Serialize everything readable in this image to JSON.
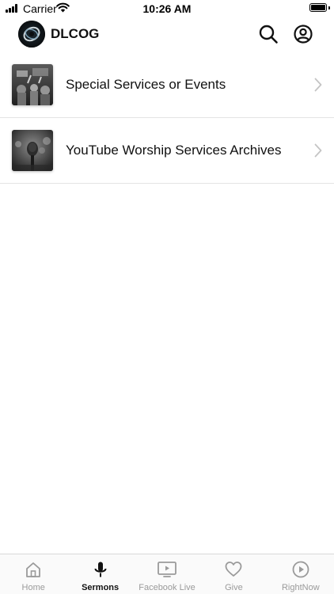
{
  "status_bar": {
    "carrier": "Carrier",
    "time": "10:26 AM"
  },
  "header": {
    "app_name": "DLCOG",
    "icons": [
      "logo-icon",
      "search-icon",
      "account-icon"
    ]
  },
  "list": {
    "items": [
      {
        "label": "Special Services or Events",
        "thumbnail": "event-photo",
        "icon": "chevron-right-icon"
      },
      {
        "label": "YouTube Worship Services Archives",
        "thumbnail": "microphone-photo",
        "icon": "chevron-right-icon"
      }
    ]
  },
  "tab_bar": {
    "active": "Sermons",
    "tabs": [
      {
        "label": "Home",
        "icon": "home-icon"
      },
      {
        "label": "Sermons",
        "icon": "microphone-icon"
      },
      {
        "label": "Facebook Live",
        "icon": "tv-play-icon"
      },
      {
        "label": "Give",
        "icon": "heart-icon"
      },
      {
        "label": "RightNow",
        "icon": "play-circle-icon"
      }
    ]
  },
  "colors": {
    "text": "#111111",
    "inactive_tab": "#9a9a9a",
    "divider": "#e4e4e4",
    "background": "#ffffff"
  }
}
